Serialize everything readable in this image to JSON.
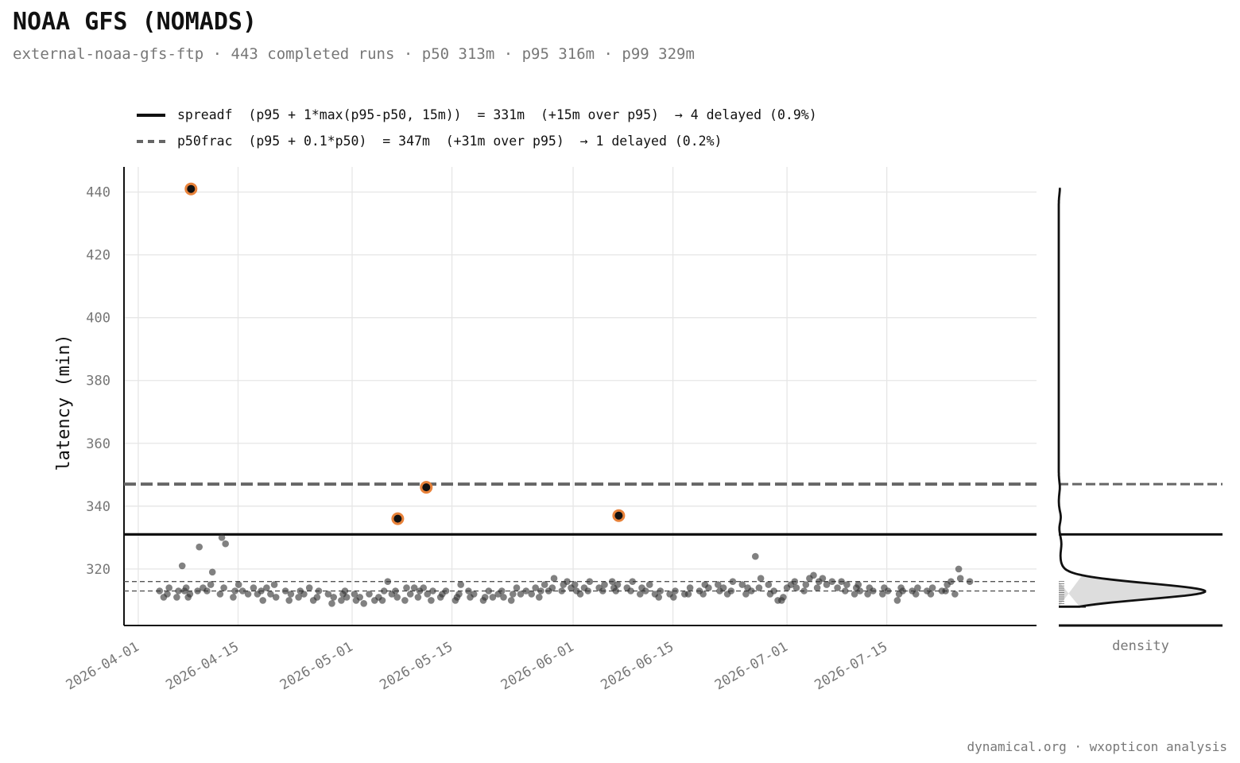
{
  "header": {
    "title": "NOAA GFS (NOMADS)",
    "subtitle": "external-noaa-gfs-ftp · 443 completed runs · p50 313m · p95 316m · p99 329m"
  },
  "legend": {
    "items": [
      {
        "style": "solid",
        "color": "#111111",
        "text": "spreadf  (p95 + 1*max(p95-p50, 15m))  = 331m  (+15m over p95)  → 4 delayed (0.9%)"
      },
      {
        "style": "dashed",
        "color": "#666666",
        "text": "p50frac  (p95 + 0.1*p50)  = 347m  (+31m over p95)  → 1 delayed (0.2%)"
      }
    ]
  },
  "footer": {
    "text": "dynamical.org · wxopticon analysis"
  },
  "colors": {
    "point": "#333333",
    "outlier_ring": "#e8823a",
    "threshold_solid": "#111111",
    "threshold_dashed": "#666666",
    "grid": "#e6e6e6",
    "density_fill": "#dddddd"
  },
  "chart_data": {
    "type": "scatter",
    "ylabel": "latency (min)",
    "density_label": "density",
    "ylim": [
      302,
      448
    ],
    "xlim": [
      "2026-03-30",
      "2026-08-05"
    ],
    "x_ticks": [
      "2026-04-01",
      "2026-04-15",
      "2026-05-01",
      "2026-05-15",
      "2026-06-01",
      "2026-06-15",
      "2026-07-01",
      "2026-07-15"
    ],
    "y_ticks": [
      320,
      340,
      360,
      380,
      400,
      420,
      440
    ],
    "grid": true,
    "thresholds": [
      {
        "name": "spreadf",
        "value": 331,
        "style": "solid"
      },
      {
        "name": "p50frac",
        "value": 347,
        "style": "dashed"
      }
    ],
    "reference_lines": [
      {
        "label": "p50",
        "value": 313
      },
      {
        "label": "p95",
        "value": 316
      }
    ],
    "outliers": [
      {
        "x": "2026-04-08",
        "y": 441
      },
      {
        "x": "2026-05-07",
        "y": 336
      },
      {
        "x": "2026-05-11",
        "y": 346
      },
      {
        "x": "2026-06-07",
        "y": 337
      }
    ],
    "points": [
      [
        "2026-04-04",
        313
      ],
      [
        "2026-04-04",
        311
      ],
      [
        "2026-04-05",
        314
      ],
      [
        "2026-04-05",
        312
      ],
      [
        "2026-04-06",
        313
      ],
      [
        "2026-04-06",
        311
      ],
      [
        "2026-04-07",
        321
      ],
      [
        "2026-04-07",
        314
      ],
      [
        "2026-04-07",
        313
      ],
      [
        "2026-04-08",
        312
      ],
      [
        "2026-04-08",
        311
      ],
      [
        "2026-04-09",
        327
      ],
      [
        "2026-04-09",
        313
      ],
      [
        "2026-04-10",
        314
      ],
      [
        "2026-04-10",
        313
      ],
      [
        "2026-04-11",
        319
      ],
      [
        "2026-04-11",
        315
      ],
      [
        "2026-04-12",
        330
      ],
      [
        "2026-04-12",
        312
      ],
      [
        "2026-04-13",
        328
      ],
      [
        "2026-04-13",
        314
      ],
      [
        "2026-04-14",
        313
      ],
      [
        "2026-04-14",
        311
      ],
      [
        "2026-04-15",
        315
      ],
      [
        "2026-04-15",
        313
      ],
      [
        "2026-04-16",
        312
      ],
      [
        "2026-04-17",
        314
      ],
      [
        "2026-04-17",
        312
      ],
      [
        "2026-04-18",
        310
      ],
      [
        "2026-04-18",
        313
      ],
      [
        "2026-04-19",
        314
      ],
      [
        "2026-04-19",
        312
      ],
      [
        "2026-04-20",
        311
      ],
      [
        "2026-04-20",
        315
      ],
      [
        "2026-04-21",
        313
      ],
      [
        "2026-04-22",
        312
      ],
      [
        "2026-04-22",
        310
      ],
      [
        "2026-04-23",
        313
      ],
      [
        "2026-04-23",
        311
      ],
      [
        "2026-04-24",
        312
      ],
      [
        "2026-04-25",
        314
      ],
      [
        "2026-04-25",
        310
      ],
      [
        "2026-04-26",
        313
      ],
      [
        "2026-04-26",
        311
      ],
      [
        "2026-04-27",
        312
      ],
      [
        "2026-04-28",
        311
      ],
      [
        "2026-04-28",
        309
      ],
      [
        "2026-04-29",
        312
      ],
      [
        "2026-04-29",
        310
      ],
      [
        "2026-04-30",
        311
      ],
      [
        "2026-04-30",
        313
      ],
      [
        "2026-05-01",
        310
      ],
      [
        "2026-05-01",
        312
      ],
      [
        "2026-05-02",
        311
      ],
      [
        "2026-05-02",
        309
      ],
      [
        "2026-05-03",
        312
      ],
      [
        "2026-05-04",
        310
      ],
      [
        "2026-05-04",
        311
      ],
      [
        "2026-05-05",
        313
      ],
      [
        "2026-05-05",
        310
      ],
      [
        "2026-05-06",
        316
      ],
      [
        "2026-05-06",
        312
      ],
      [
        "2026-05-07",
        311
      ],
      [
        "2026-05-07",
        313
      ],
      [
        "2026-05-08",
        314
      ],
      [
        "2026-05-08",
        310
      ],
      [
        "2026-05-09",
        312
      ],
      [
        "2026-05-09",
        314
      ],
      [
        "2026-05-10",
        313
      ],
      [
        "2026-05-10",
        311
      ],
      [
        "2026-05-11",
        314
      ],
      [
        "2026-05-11",
        312
      ],
      [
        "2026-05-12",
        313
      ],
      [
        "2026-05-12",
        310
      ],
      [
        "2026-05-13",
        312
      ],
      [
        "2026-05-13",
        311
      ],
      [
        "2026-05-14",
        313
      ],
      [
        "2026-05-15",
        311
      ],
      [
        "2026-05-15",
        310
      ],
      [
        "2026-05-16",
        315
      ],
      [
        "2026-05-16",
        312
      ],
      [
        "2026-05-17",
        311
      ],
      [
        "2026-05-17",
        313
      ],
      [
        "2026-05-18",
        312
      ],
      [
        "2026-05-19",
        311
      ],
      [
        "2026-05-19",
        310
      ],
      [
        "2026-05-20",
        313
      ],
      [
        "2026-05-20",
        311
      ],
      [
        "2026-05-21",
        312
      ],
      [
        "2026-05-22",
        311
      ],
      [
        "2026-05-22",
        313
      ],
      [
        "2026-05-23",
        312
      ],
      [
        "2026-05-23",
        310
      ],
      [
        "2026-05-24",
        314
      ],
      [
        "2026-05-24",
        312
      ],
      [
        "2026-05-25",
        313
      ],
      [
        "2026-05-26",
        312
      ],
      [
        "2026-05-26",
        314
      ],
      [
        "2026-05-27",
        313
      ],
      [
        "2026-05-27",
        311
      ],
      [
        "2026-05-28",
        315
      ],
      [
        "2026-05-28",
        313
      ],
      [
        "2026-05-29",
        317
      ],
      [
        "2026-05-29",
        314
      ],
      [
        "2026-05-30",
        315
      ],
      [
        "2026-05-30",
        313
      ],
      [
        "2026-05-31",
        316
      ],
      [
        "2026-05-31",
        314
      ],
      [
        "2026-06-01",
        313
      ],
      [
        "2026-06-01",
        315
      ],
      [
        "2026-06-02",
        312
      ],
      [
        "2026-06-02",
        314
      ],
      [
        "2026-06-03",
        316
      ],
      [
        "2026-06-03",
        313
      ],
      [
        "2026-06-04",
        314
      ],
      [
        "2026-06-05",
        315
      ],
      [
        "2026-06-05",
        313
      ],
      [
        "2026-06-06",
        314
      ],
      [
        "2026-06-06",
        316
      ],
      [
        "2026-06-07",
        315
      ],
      [
        "2026-06-07",
        313
      ],
      [
        "2026-06-08",
        314
      ],
      [
        "2026-06-09",
        316
      ],
      [
        "2026-06-09",
        313
      ],
      [
        "2026-06-10",
        314
      ],
      [
        "2026-06-10",
        312
      ],
      [
        "2026-06-11",
        313
      ],
      [
        "2026-06-11",
        315
      ],
      [
        "2026-06-12",
        312
      ],
      [
        "2026-06-13",
        313
      ],
      [
        "2026-06-13",
        311
      ],
      [
        "2026-06-14",
        312
      ],
      [
        "2026-06-15",
        313
      ],
      [
        "2026-06-15",
        311
      ],
      [
        "2026-06-16",
        312
      ],
      [
        "2026-06-17",
        314
      ],
      [
        "2026-06-17",
        312
      ],
      [
        "2026-06-18",
        313
      ],
      [
        "2026-06-19",
        315
      ],
      [
        "2026-06-19",
        312
      ],
      [
        "2026-06-20",
        314
      ],
      [
        "2026-06-21",
        313
      ],
      [
        "2026-06-21",
        315
      ],
      [
        "2026-06-22",
        314
      ],
      [
        "2026-06-22",
        312
      ],
      [
        "2026-06-23",
        316
      ],
      [
        "2026-06-23",
        313
      ],
      [
        "2026-06-24",
        315
      ],
      [
        "2026-06-25",
        314
      ],
      [
        "2026-06-25",
        312
      ],
      [
        "2026-06-26",
        313
      ],
      [
        "2026-06-26",
        324
      ],
      [
        "2026-06-27",
        317
      ],
      [
        "2026-06-27",
        314
      ],
      [
        "2026-06-28",
        312
      ],
      [
        "2026-06-28",
        315
      ],
      [
        "2026-06-29",
        313
      ],
      [
        "2026-06-29",
        310
      ],
      [
        "2026-06-30",
        311
      ],
      [
        "2026-06-30",
        310
      ],
      [
        "2026-07-01",
        314
      ],
      [
        "2026-07-01",
        315
      ],
      [
        "2026-07-02",
        314
      ],
      [
        "2026-07-02",
        316
      ],
      [
        "2026-07-03",
        315
      ],
      [
        "2026-07-03",
        313
      ],
      [
        "2026-07-04",
        317
      ],
      [
        "2026-07-04",
        318
      ],
      [
        "2026-07-05",
        316
      ],
      [
        "2026-07-05",
        314
      ],
      [
        "2026-07-06",
        317
      ],
      [
        "2026-07-06",
        315
      ],
      [
        "2026-07-07",
        316
      ],
      [
        "2026-07-08",
        314
      ],
      [
        "2026-07-08",
        316
      ],
      [
        "2026-07-09",
        315
      ],
      [
        "2026-07-09",
        313
      ],
      [
        "2026-07-10",
        314
      ],
      [
        "2026-07-10",
        312
      ],
      [
        "2026-07-11",
        313
      ],
      [
        "2026-07-11",
        315
      ],
      [
        "2026-07-12",
        314
      ],
      [
        "2026-07-12",
        312
      ],
      [
        "2026-07-13",
        313
      ],
      [
        "2026-07-14",
        314
      ],
      [
        "2026-07-14",
        312
      ],
      [
        "2026-07-15",
        313
      ],
      [
        "2026-07-16",
        312
      ],
      [
        "2026-07-16",
        310
      ],
      [
        "2026-07-17",
        313
      ],
      [
        "2026-07-17",
        314
      ],
      [
        "2026-07-18",
        313
      ],
      [
        "2026-07-19",
        314
      ],
      [
        "2026-07-19",
        312
      ],
      [
        "2026-07-20",
        313
      ],
      [
        "2026-07-21",
        314
      ],
      [
        "2026-07-21",
        312
      ],
      [
        "2026-07-22",
        313
      ],
      [
        "2026-07-23",
        315
      ],
      [
        "2026-07-23",
        313
      ],
      [
        "2026-07-24",
        316
      ],
      [
        "2026-07-24",
        312
      ],
      [
        "2026-07-25",
        317
      ],
      [
        "2026-07-25",
        320
      ],
      [
        "2026-07-26",
        316
      ]
    ]
  }
}
